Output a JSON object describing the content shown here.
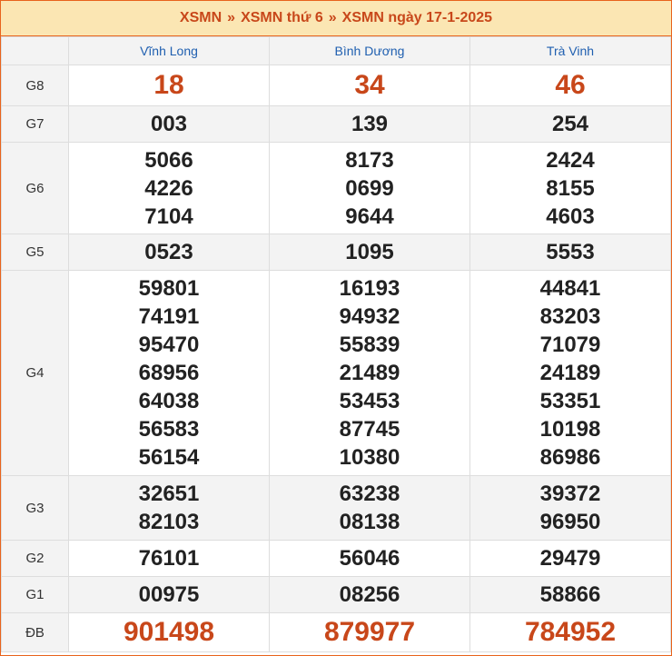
{
  "breadcrumb": {
    "items": [
      "XSMN",
      "XSMN thứ 6",
      "XSMN ngày 17-1-2025"
    ],
    "separator": "»"
  },
  "table": {
    "corner": "",
    "provinces": [
      "Vĩnh Long",
      "Bình Dương",
      "Trà Vinh"
    ],
    "rows": [
      {
        "label": "G8",
        "style": "big",
        "values": [
          [
            "18"
          ],
          [
            "34"
          ],
          [
            "46"
          ]
        ]
      },
      {
        "label": "G7",
        "style": "num",
        "values": [
          [
            "003"
          ],
          [
            "139"
          ],
          [
            "254"
          ]
        ]
      },
      {
        "label": "G6",
        "style": "num",
        "values": [
          [
            "5066",
            "4226",
            "7104"
          ],
          [
            "8173",
            "0699",
            "9644"
          ],
          [
            "2424",
            "8155",
            "4603"
          ]
        ]
      },
      {
        "label": "G5",
        "style": "num",
        "values": [
          [
            "0523"
          ],
          [
            "1095"
          ],
          [
            "5553"
          ]
        ]
      },
      {
        "label": "G4",
        "style": "num",
        "values": [
          [
            "59801",
            "74191",
            "95470",
            "68956",
            "64038",
            "56583",
            "56154"
          ],
          [
            "16193",
            "94932",
            "55839",
            "21489",
            "53453",
            "87745",
            "10380"
          ],
          [
            "44841",
            "83203",
            "71079",
            "24189",
            "53351",
            "10198",
            "86986"
          ]
        ]
      },
      {
        "label": "G3",
        "style": "num",
        "values": [
          [
            "32651",
            "82103"
          ],
          [
            "63238",
            "08138"
          ],
          [
            "39372",
            "96950"
          ]
        ]
      },
      {
        "label": "G2",
        "style": "num",
        "values": [
          [
            "76101"
          ],
          [
            "56046"
          ],
          [
            "29479"
          ]
        ]
      },
      {
        "label": "G1",
        "style": "num",
        "values": [
          [
            "00975"
          ],
          [
            "08256"
          ],
          [
            "58866"
          ]
        ]
      },
      {
        "label": "ĐB",
        "style": "big",
        "values": [
          [
            "901498"
          ],
          [
            "879977"
          ],
          [
            "784952"
          ]
        ]
      }
    ]
  },
  "colors": {
    "accent": "#c8471a",
    "header_bg": "#fbe6b3",
    "province_text": "#1f5fb0",
    "alt_row_bg": "#f3f3f3"
  }
}
